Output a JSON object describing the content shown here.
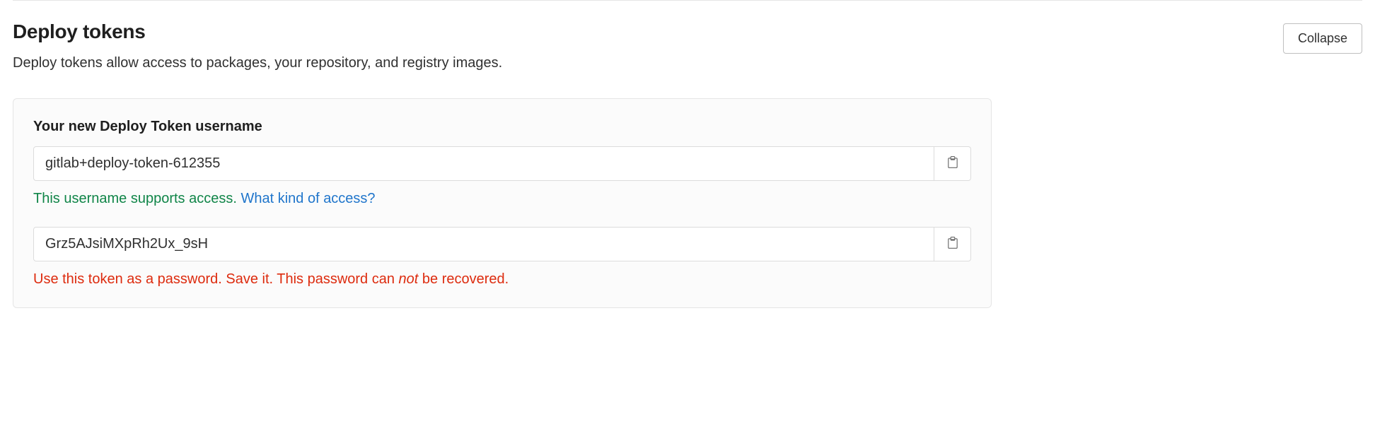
{
  "section": {
    "title": "Deploy tokens",
    "description": "Deploy tokens allow access to packages, your repository, and registry images.",
    "collapse_label": "Collapse"
  },
  "card": {
    "username_label": "Your new Deploy Token username",
    "username_value": "gitlab+deploy-token-612355",
    "username_helper_text": "This username supports access. ",
    "username_helper_link": "What kind of access?",
    "token_value": "Grz5AJsiMXpRh2Ux_9sH",
    "token_helper_prefix": "Use this token as a password. Save it. This password can ",
    "token_helper_em": "not",
    "token_helper_suffix": " be recovered."
  }
}
